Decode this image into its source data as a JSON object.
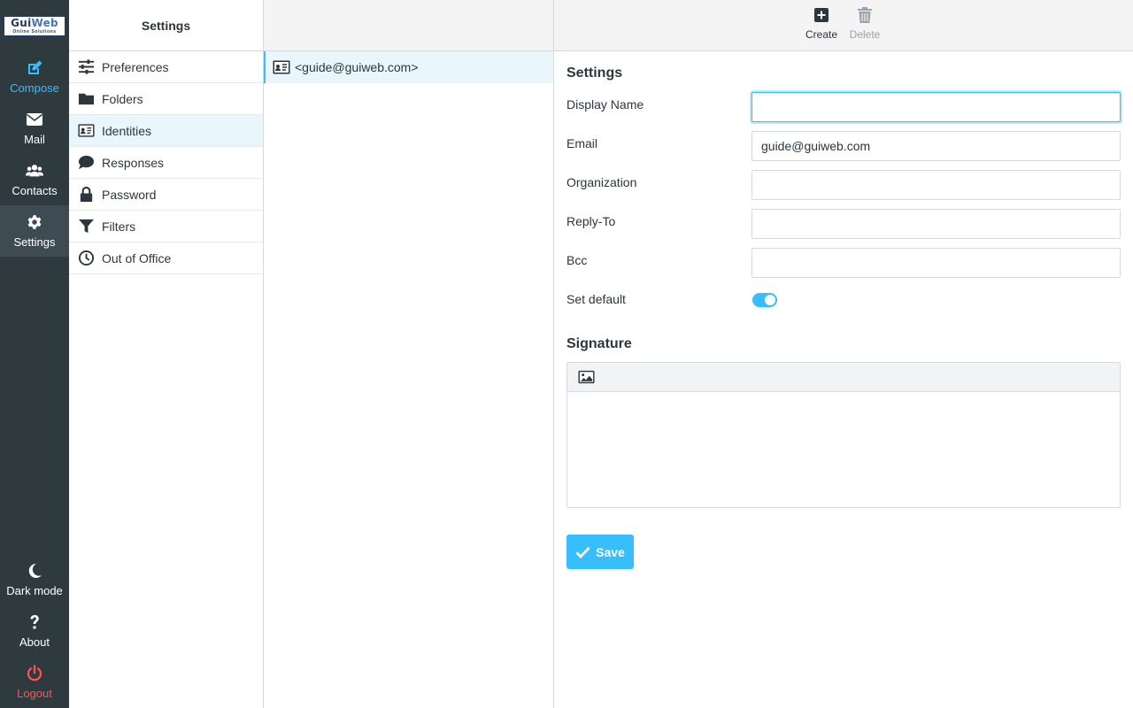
{
  "logo": {
    "text_part1": "Gui",
    "text_part2": "Web",
    "tagline": "Online Solutions"
  },
  "nav": {
    "compose": "Compose",
    "mail": "Mail",
    "contacts": "Contacts",
    "settings": "Settings",
    "dark_mode": "Dark mode",
    "about": "About",
    "logout": "Logout"
  },
  "settings_menu": {
    "header": "Settings",
    "items": [
      {
        "label": "Preferences",
        "icon": "sliders-icon"
      },
      {
        "label": "Folders",
        "icon": "folder-icon"
      },
      {
        "label": "Identities",
        "icon": "id-card-icon",
        "selected": true
      },
      {
        "label": "Responses",
        "icon": "comment-icon"
      },
      {
        "label": "Password",
        "icon": "lock-icon"
      },
      {
        "label": "Filters",
        "icon": "filter-icon"
      },
      {
        "label": "Out of Office",
        "icon": "clock-icon"
      }
    ]
  },
  "identities": [
    {
      "label": "<guide@guiweb.com>"
    }
  ],
  "toolbar": {
    "create": "Create",
    "delete": "Delete"
  },
  "form": {
    "section_title": "Settings",
    "display_name": {
      "label": "Display Name",
      "value": ""
    },
    "email": {
      "label": "Email",
      "value": "guide@guiweb.com"
    },
    "organization": {
      "label": "Organization",
      "value": ""
    },
    "reply_to": {
      "label": "Reply-To",
      "value": ""
    },
    "bcc": {
      "label": "Bcc",
      "value": ""
    },
    "set_default": {
      "label": "Set default",
      "on": true
    },
    "signature_title": "Signature",
    "save": "Save"
  },
  "colors": {
    "accent": "#37beff",
    "nav_bg": "#2f3a3f",
    "logout": "#ff5552"
  }
}
